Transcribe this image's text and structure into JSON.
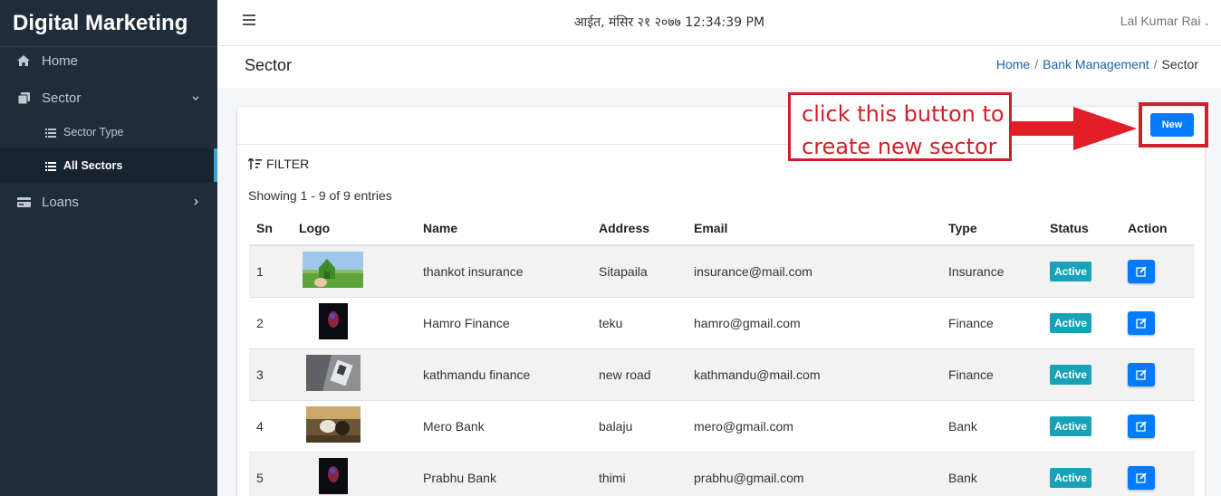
{
  "brand": "Digital Marketing",
  "sidebar": {
    "home": "Home",
    "sector": "Sector",
    "sector_type": "Sector Type",
    "all_sectors": "All Sectors",
    "loans": "Loans"
  },
  "header": {
    "datetime": "आईत, मंसिर २१ २०७७ 12:34:39 PM",
    "user": "Lal Kumar Rai"
  },
  "page": {
    "title": "Sector",
    "breadcrumb": [
      "Home",
      "Bank Management",
      "Sector"
    ]
  },
  "card": {
    "new_button": "New",
    "filter": "FILTER",
    "showing": "Showing 1 - 9 of 9 entries"
  },
  "table": {
    "headers": [
      "Sn",
      "Logo",
      "Name",
      "Address",
      "Email",
      "Type",
      "Status",
      "Action"
    ],
    "rows": [
      {
        "sn": "1",
        "logo": "house-image",
        "name": "thankot insurance",
        "address": "Sitapaila",
        "email": "insurance@mail.com",
        "type": "Insurance",
        "status": "Active"
      },
      {
        "sn": "2",
        "logo": "dark-image",
        "name": "Hamro Finance",
        "address": "teku",
        "email": "hamro@gmail.com",
        "type": "Finance",
        "status": "Active"
      },
      {
        "sn": "3",
        "logo": "laptop-image",
        "name": "kathmandu finance",
        "address": "new road",
        "email": "kathmandu@mail.com",
        "type": "Finance",
        "status": "Active"
      },
      {
        "sn": "4",
        "logo": "horse-image",
        "name": "Mero Bank",
        "address": "balaju",
        "email": "mero@gmail.com",
        "type": "Bank",
        "status": "Active"
      },
      {
        "sn": "5",
        "logo": "dark-image",
        "name": "Prabhu Bank",
        "address": "thimi",
        "email": "prabhu@gmail.com",
        "type": "Bank",
        "status": "Active"
      }
    ]
  },
  "annotation": {
    "line1": "click this button to",
    "line2": "create new sector"
  },
  "colors": {
    "sidebar_bg": "#1f2d3a",
    "primary": "#007bff",
    "badge": "#17a2b8",
    "annotation_red": "#d0212a"
  }
}
